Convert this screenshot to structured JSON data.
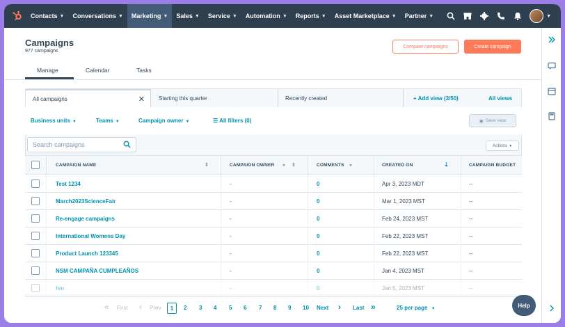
{
  "nav": {
    "items": [
      {
        "label": "Contacts"
      },
      {
        "label": "Conversations"
      },
      {
        "label": "Marketing"
      },
      {
        "label": "Sales"
      },
      {
        "label": "Service"
      },
      {
        "label": "Automation"
      },
      {
        "label": "Reports"
      },
      {
        "label": "Asset Marketplace"
      },
      {
        "label": "Partner"
      }
    ],
    "active_item": "Marketing",
    "right_icons": [
      "search-icon",
      "marketplace-icon",
      "settings-icon",
      "calling-icon",
      "notifications-icon",
      "avatar"
    ]
  },
  "header": {
    "title": "Campaigns",
    "subtitle": "977 campaigns",
    "compare_button": "Compare campaigns",
    "create_button": "Create campaign"
  },
  "tabs": [
    {
      "label": "Manage",
      "active": true
    },
    {
      "label": "Calendar",
      "active": false
    },
    {
      "label": "Tasks",
      "active": false
    }
  ],
  "views": {
    "tabs": [
      {
        "label": "All campaigns",
        "active": true
      },
      {
        "label": "Starting this quarter",
        "active": false
      },
      {
        "label": "Recently created",
        "active": false
      }
    ],
    "add_view": "+ Add view (3/50)",
    "all_views": "All views"
  },
  "filters": {
    "business_units": "Business units",
    "teams": "Teams",
    "campaign_owner": "Campaign owner",
    "all_filters": "All filters (0)",
    "save_view": "Save view"
  },
  "search": {
    "placeholder": "Search campaigns"
  },
  "actions_label": "Actions",
  "table": {
    "columns": [
      "CAMPAIGN NAME",
      "CAMPAIGN OWNER",
      "COMMENTS",
      "CREATED ON",
      "CAMPAIGN BUDGET"
    ],
    "rows": [
      {
        "name": "Test 1234",
        "owner": "-",
        "comments": "0",
        "created": "Apr 3, 2023 MDT",
        "budget": "--"
      },
      {
        "name": "March2023ScienceFair",
        "owner": "-",
        "comments": "0",
        "created": "Mar 1, 2023 MST",
        "budget": "--"
      },
      {
        "name": "Re-engage campaigns",
        "owner": "-",
        "comments": "0",
        "created": "Feb 24, 2023 MST",
        "budget": "--"
      },
      {
        "name": "International Womens Day",
        "owner": "-",
        "comments": "0",
        "created": "Feb 22, 2023 MST",
        "budget": "--"
      },
      {
        "name": "Product Launch 123345",
        "owner": "-",
        "comments": "0",
        "created": "Feb 22, 2023 MST",
        "budget": "--"
      },
      {
        "name": "NSM CAMPAÑA CUMPLEAÑOS",
        "owner": "-",
        "comments": "0",
        "created": "Jan 4, 2023 MST",
        "budget": "--"
      },
      {
        "name": "hm",
        "owner": "-",
        "comments": "0",
        "created": "Jan 5, 2023 MST",
        "budget": "--"
      }
    ]
  },
  "pagination": {
    "first": "First",
    "prev": "Prev",
    "pages": [
      "1",
      "2",
      "3",
      "4",
      "5",
      "6",
      "7",
      "8",
      "9",
      "10"
    ],
    "current": "1",
    "next": "Next",
    "last": "Last",
    "per_page": "25 per page"
  },
  "help_label": "Help",
  "colors": {
    "nav_bg": "#2e3f50",
    "accent": "#ff7a59",
    "link": "#0091ae",
    "frame": "#9b7fe6"
  }
}
